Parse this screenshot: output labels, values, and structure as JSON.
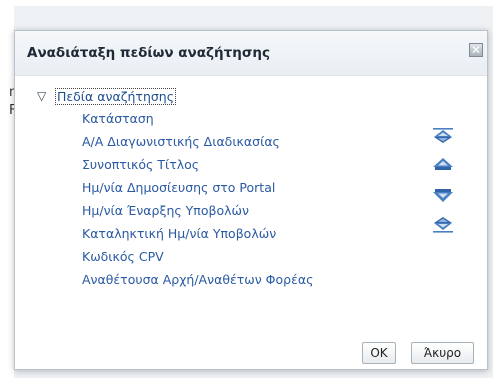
{
  "background": {
    "fragments": [
      "n",
      "F"
    ]
  },
  "dialog": {
    "title": "Αναδιάταξη πεδίων αναζήτησης",
    "close_symbol": "✕",
    "tree": {
      "root_label": "Πεδία αναζήτησης",
      "toggle_icon": "triangle-down-icon",
      "fields": [
        "Κατάσταση",
        "Α/Α Διαγωνιστικής Διαδικασίας",
        "Συνοπτικός Τίτλος",
        "Ημ/νία Δημοσίευσης στο Portal",
        "Ημ/νία Έναρξης Υποβολών",
        "Καταληκτική Ημ/νία Υποβολών",
        "Κωδικός CPV",
        "Αναθέτουσα Αρχή/Αναθέτων Φορέας"
      ]
    },
    "move_buttons": [
      {
        "icon": "move-top-icon"
      },
      {
        "icon": "move-up-icon"
      },
      {
        "icon": "move-down-icon"
      },
      {
        "icon": "move-bottom-icon"
      }
    ],
    "ok_label": "OK",
    "cancel_label": "Άκυρο"
  },
  "colors": {
    "accent_blue": "#2a5aa3",
    "icon_blue": "#4a7fc1"
  }
}
